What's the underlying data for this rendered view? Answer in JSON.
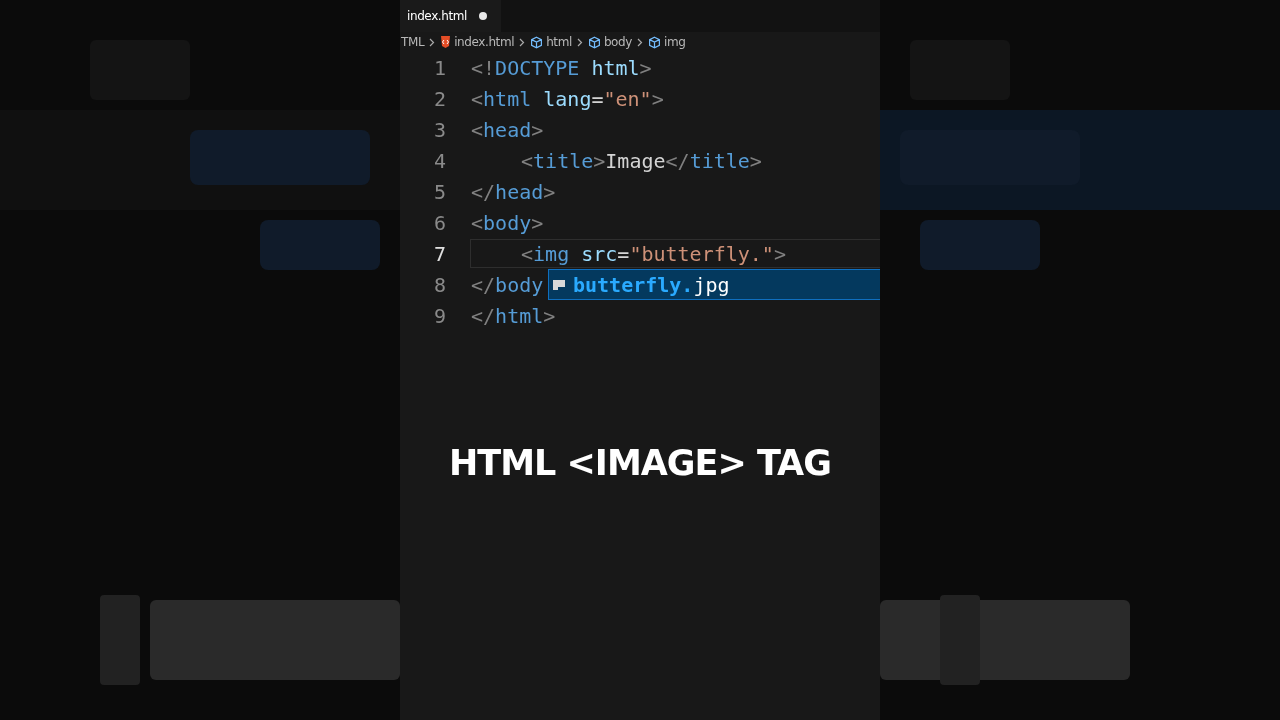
{
  "tab": {
    "label": "index.html",
    "modified": true
  },
  "breadcrumbs": [
    {
      "kind": "text",
      "label": "TML"
    },
    {
      "kind": "file",
      "label": "index.html"
    },
    {
      "kind": "symbol",
      "label": "html"
    },
    {
      "kind": "symbol",
      "label": "body"
    },
    {
      "kind": "symbol",
      "label": "img"
    }
  ],
  "lines": [
    {
      "number": "1",
      "indent": false,
      "active": false,
      "tokens": [
        {
          "kind": "punct",
          "text": "<!"
        },
        {
          "kind": "tag",
          "text": "DOCTYPE"
        },
        {
          "kind": "attr",
          "text": " html"
        },
        {
          "kind": "punct",
          "text": ">"
        }
      ]
    },
    {
      "number": "2",
      "indent": false,
      "active": false,
      "tokens": [
        {
          "kind": "punct",
          "text": "<"
        },
        {
          "kind": "tag",
          "text": "html"
        },
        {
          "kind": "attr",
          "text": " lang"
        },
        {
          "kind": "text",
          "text": "="
        },
        {
          "kind": "string",
          "text": "\"en\""
        },
        {
          "kind": "punct",
          "text": ">"
        }
      ]
    },
    {
      "number": "3",
      "indent": false,
      "active": false,
      "tokens": [
        {
          "kind": "punct",
          "text": "<"
        },
        {
          "kind": "tag",
          "text": "head"
        },
        {
          "kind": "punct",
          "text": ">"
        }
      ]
    },
    {
      "number": "4",
      "indent": true,
      "active": false,
      "tokens": [
        {
          "kind": "punct",
          "text": "<"
        },
        {
          "kind": "tag",
          "text": "title"
        },
        {
          "kind": "punct",
          "text": ">"
        },
        {
          "kind": "text",
          "text": "Image"
        },
        {
          "kind": "punct",
          "text": "</"
        },
        {
          "kind": "tag",
          "text": "title"
        },
        {
          "kind": "punct",
          "text": ">"
        }
      ]
    },
    {
      "number": "5",
      "indent": false,
      "active": false,
      "tokens": [
        {
          "kind": "punct",
          "text": "</"
        },
        {
          "kind": "tag",
          "text": "head"
        },
        {
          "kind": "punct",
          "text": ">"
        }
      ]
    },
    {
      "number": "6",
      "indent": false,
      "active": false,
      "tokens": [
        {
          "kind": "punct",
          "text": "<"
        },
        {
          "kind": "tag",
          "text": "body"
        },
        {
          "kind": "punct",
          "text": ">"
        }
      ]
    },
    {
      "number": "7",
      "indent": true,
      "active": true,
      "tokens": [
        {
          "kind": "punct",
          "text": "<"
        },
        {
          "kind": "tag",
          "text": "img"
        },
        {
          "kind": "attr",
          "text": " src"
        },
        {
          "kind": "text",
          "text": "="
        },
        {
          "kind": "string",
          "text": "\""
        },
        {
          "kind": "string",
          "text": "butterfly."
        },
        {
          "kind": "string",
          "text": "\""
        },
        {
          "kind": "punct",
          "text": ">"
        }
      ]
    },
    {
      "number": "8",
      "indent": false,
      "active": false,
      "tokens": [
        {
          "kind": "punct",
          "text": "</"
        },
        {
          "kind": "tag",
          "text": "body"
        }
      ]
    },
    {
      "number": "9",
      "indent": false,
      "active": false,
      "tokens": [
        {
          "kind": "punct",
          "text": "</"
        },
        {
          "kind": "tag",
          "text": "html"
        },
        {
          "kind": "punct",
          "text": ">"
        }
      ]
    }
  ],
  "suggestion": {
    "match": "butterfly.",
    "rest": "jpg"
  },
  "caption": "HTML <IMAGE> TAG"
}
